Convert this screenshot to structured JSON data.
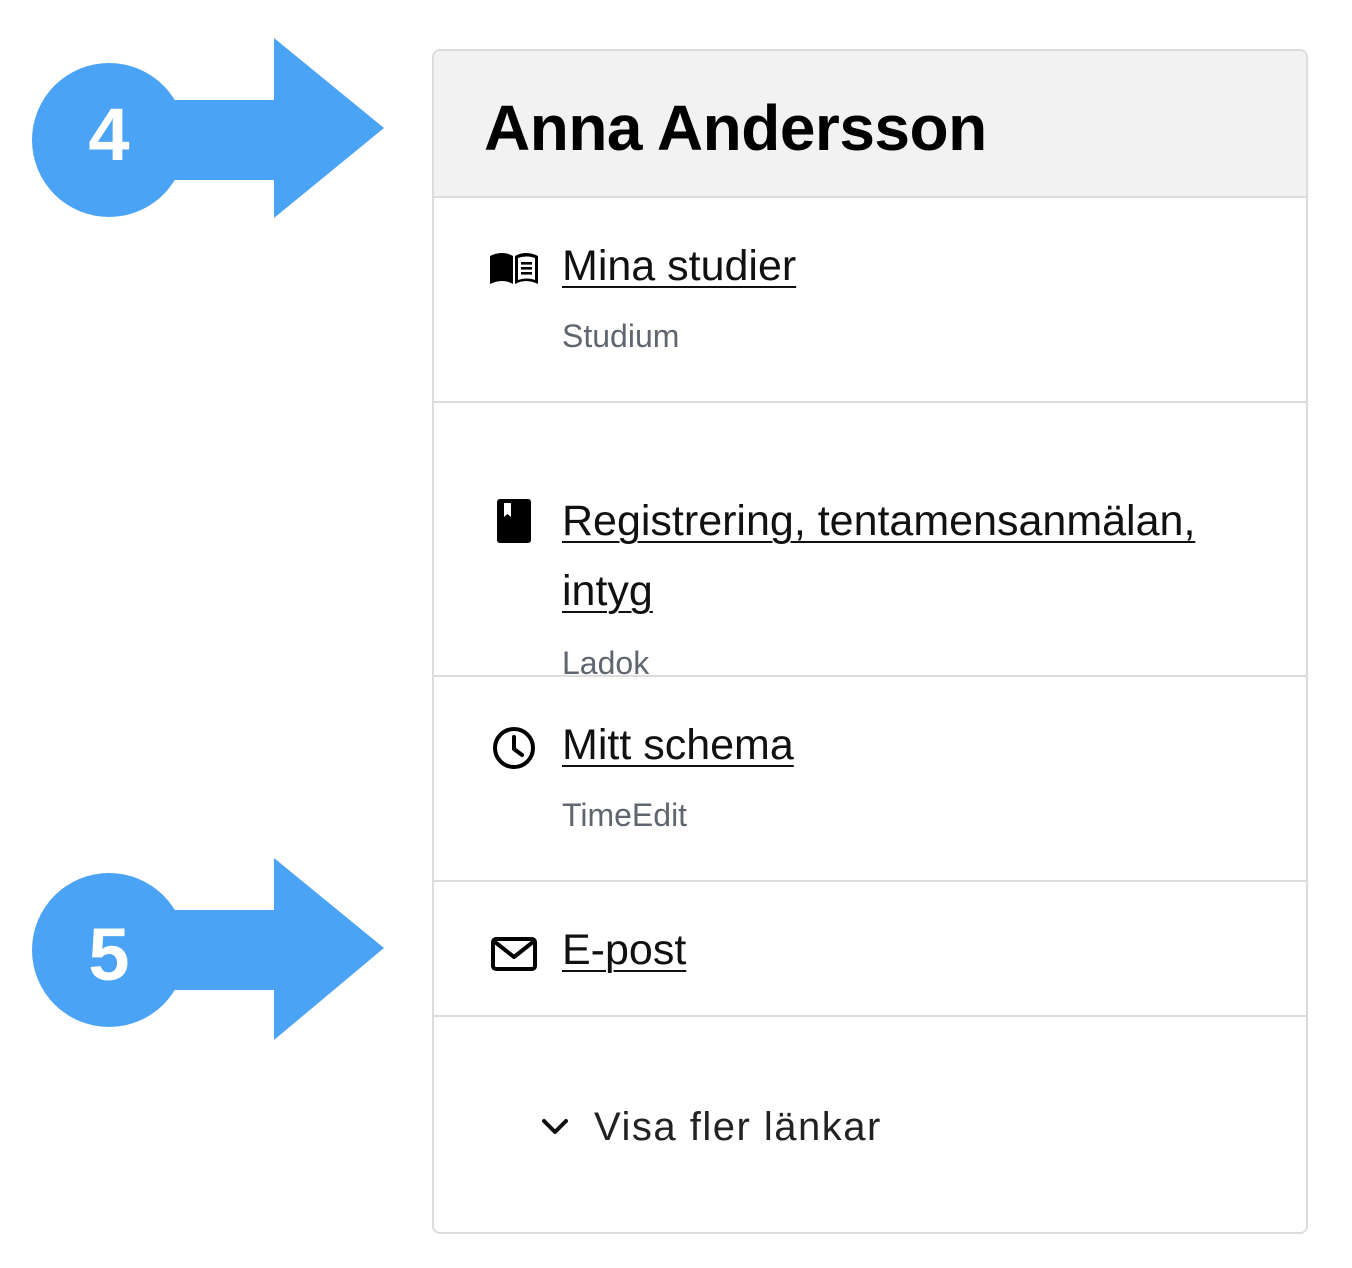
{
  "callouts": [
    {
      "number": "4",
      "color": "#4aa3f5"
    },
    {
      "number": "5",
      "color": "#4aa3f5"
    }
  ],
  "card": {
    "title": "Anna Andersson",
    "links": [
      {
        "label": "Mina studier",
        "sublabel": "Studium",
        "icon": "open-book-icon"
      },
      {
        "label": "Registrering, tentamensanmälan, intyg",
        "sublabel": "Ladok",
        "icon": "closed-book-icon"
      },
      {
        "label": "Mitt schema",
        "sublabel": "TimeEdit",
        "icon": "clock-icon"
      },
      {
        "label": "E-post",
        "icon": "envelope-icon"
      }
    ],
    "more_links_label": "Visa fler länkar",
    "more_links_icon": "chevron-down-icon"
  },
  "colors": {
    "callout": "#4aa3f5",
    "header_bg": "#f2f2f2",
    "border": "#dcdcdc",
    "sublabel": "#5f6670"
  }
}
